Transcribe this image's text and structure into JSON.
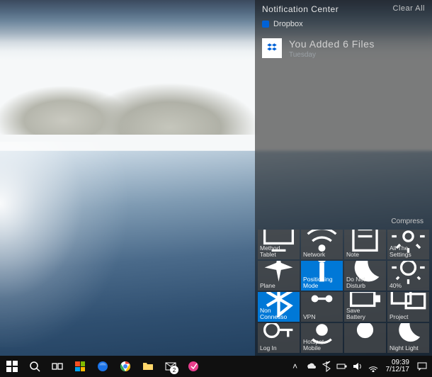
{
  "action_center": {
    "title": "Notification Center",
    "clear_all": "Clear All",
    "collapse": "Compress",
    "notifications": [
      {
        "app_name": "Dropbox",
        "icon": "dropbox-icon",
        "title": "You Added 6 Files",
        "time": "Tuesday"
      }
    ],
    "tiles": [
      {
        "id": "tablet-mode",
        "icon": "tablet-icon",
        "label": "Method\nTablet",
        "active": false
      },
      {
        "id": "network",
        "icon": "wifi-icon",
        "label": "Network",
        "active": false
      },
      {
        "id": "note",
        "icon": "note-icon",
        "label": "Note",
        "active": false
      },
      {
        "id": "settings",
        "icon": "settings-icon",
        "label": "All The\nSettings",
        "active": false
      },
      {
        "id": "airplane",
        "icon": "airplane-icon",
        "label": "Plane",
        "active": false
      },
      {
        "id": "location",
        "icon": "location-icon",
        "label": "Positioning Mode",
        "active": true
      },
      {
        "id": "dnd",
        "icon": "moon-icon",
        "label": "Do Not Disturb",
        "active": false
      },
      {
        "id": "brightness",
        "icon": "brightness-icon",
        "label": "40%",
        "active": false
      },
      {
        "id": "bluetooth",
        "icon": "bluetooth-icon",
        "label": "Non Connesso",
        "active": true
      },
      {
        "id": "vpn",
        "icon": "vpn-icon",
        "label": "VPN",
        "active": false
      },
      {
        "id": "battery-saver",
        "icon": "battery-icon",
        "label": "Save\nBattery",
        "active": false
      },
      {
        "id": "project",
        "icon": "project-icon",
        "label": "Project",
        "active": false
      },
      {
        "id": "login",
        "icon": "key-icon",
        "label": "Log In",
        "active": false
      },
      {
        "id": "hotspot",
        "icon": "hotspot-icon",
        "label": "Hotspot\nMobile",
        "active": false
      },
      {
        "id": "nightlight-a",
        "icon": "sun-icon",
        "label": "",
        "active": false
      },
      {
        "id": "nightlight",
        "icon": "night-icon",
        "label": "Night Light",
        "active": false
      }
    ]
  },
  "taskbar": {
    "mail_badge": "2",
    "clock_time": "09:39",
    "clock_date": "7/12/17",
    "tray": [
      "chevron-up-icon",
      "onedrive-icon",
      "bluetooth-icon",
      "battery-icon",
      "sound-icon",
      "wifi-icon"
    ]
  }
}
